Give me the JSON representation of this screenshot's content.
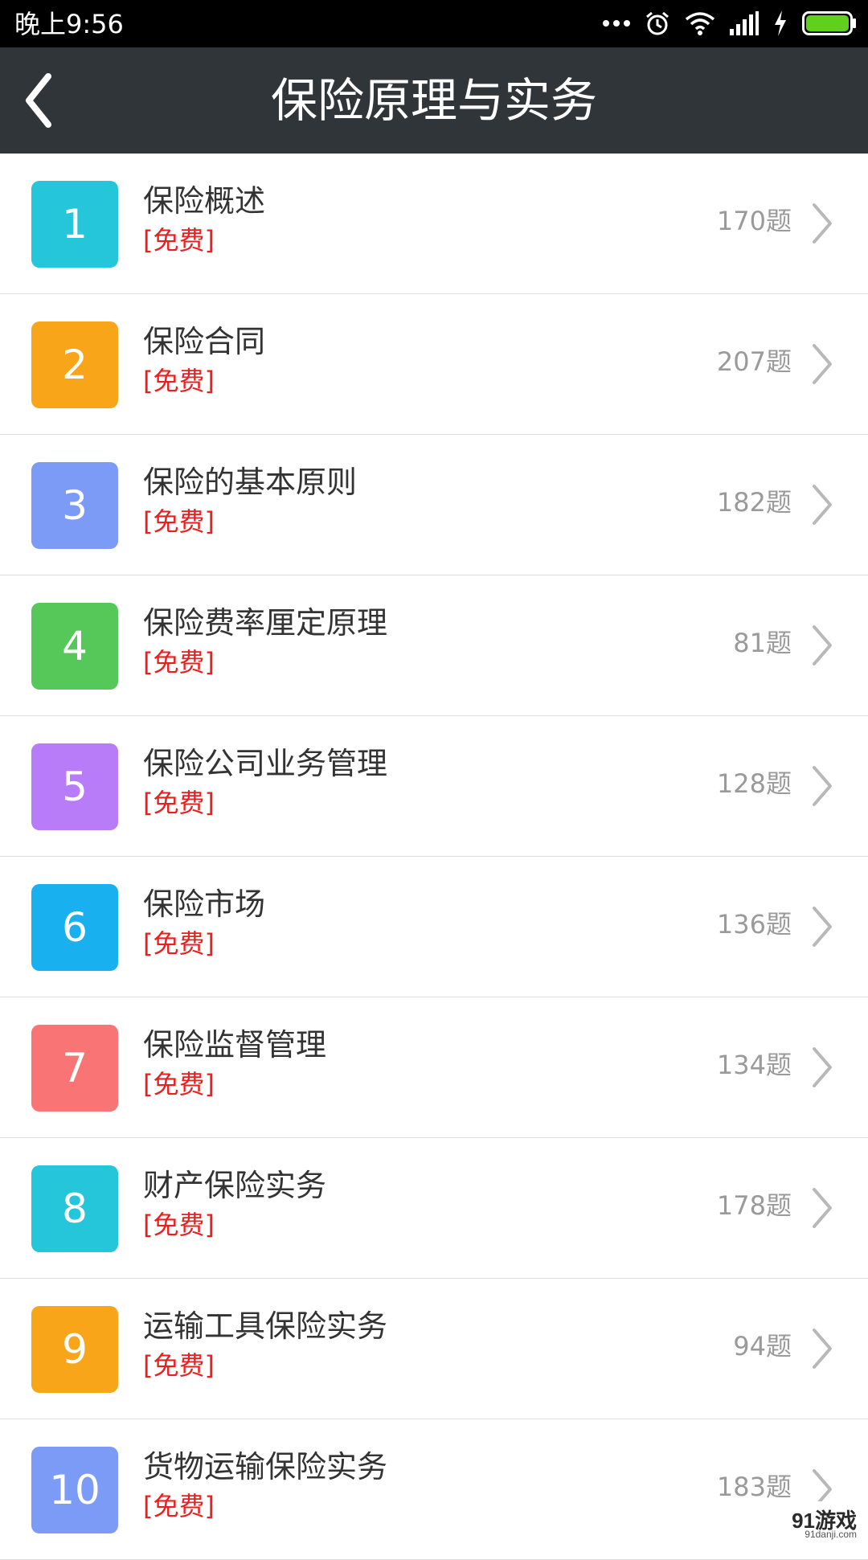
{
  "status_bar": {
    "time": "晚上9:56",
    "icons": [
      "more-dots-icon",
      "alarm-icon",
      "wifi-icon",
      "signal-icon",
      "charging-icon",
      "battery-icon"
    ],
    "battery_color": "#5fd11c"
  },
  "header": {
    "title": "保险原理与实务",
    "back_icon": "chevron-left-icon",
    "background": "#303539"
  },
  "chapters": [
    {
      "number": "1",
      "title": "保险概述",
      "tag": "[免费]",
      "count": "170题",
      "color": "#25c6da"
    },
    {
      "number": "2",
      "title": "保险合同",
      "tag": "[免费]",
      "count": "207题",
      "color": "#f9a51a"
    },
    {
      "number": "3",
      "title": "保险的基本原则",
      "tag": "[免费]",
      "count": "182题",
      "color": "#7b9bf7"
    },
    {
      "number": "4",
      "title": "保险费率厘定原理",
      "tag": "[免费]",
      "count": "81题",
      "color": "#56c85a"
    },
    {
      "number": "5",
      "title": "保险公司业务管理",
      "tag": "[免费]",
      "count": "128题",
      "color": "#b87cf8"
    },
    {
      "number": "6",
      "title": "保险市场",
      "tag": "[免费]",
      "count": "136题",
      "color": "#18b0ee"
    },
    {
      "number": "7",
      "title": "保险监督管理",
      "tag": "[免费]",
      "count": "134题",
      "color": "#f97474"
    },
    {
      "number": "8",
      "title": "财产保险实务",
      "tag": "[免费]",
      "count": "178题",
      "color": "#25c6da"
    },
    {
      "number": "9",
      "title": "运输工具保险实务",
      "tag": "[免费]",
      "count": "94题",
      "color": "#f9a51a"
    },
    {
      "number": "10",
      "title": "货物运输保险实务",
      "tag": "[免费]",
      "count": "183题",
      "color": "#7b9bf7"
    }
  ],
  "watermark": {
    "logo": "91游戏",
    "url": "91danji.com"
  }
}
